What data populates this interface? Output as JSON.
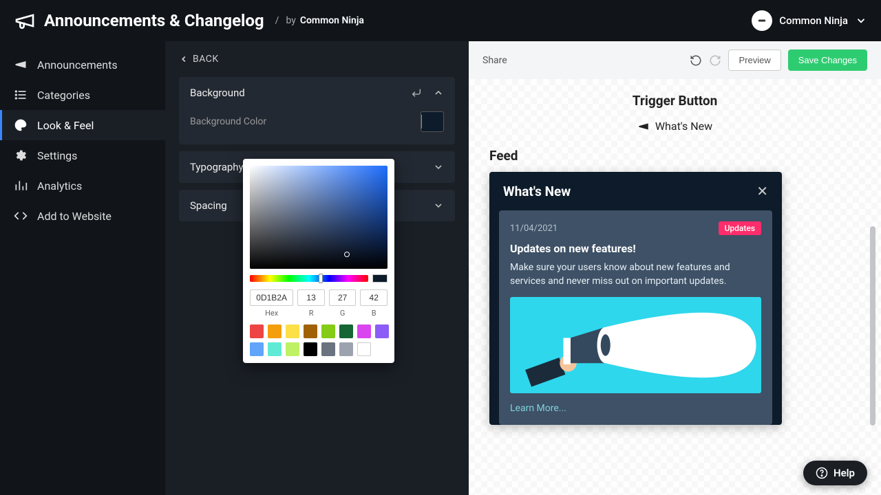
{
  "header": {
    "title": "Announcements & Changelog",
    "by_label": "by",
    "by_name": "Common Ninja",
    "user_name": "Common Ninja"
  },
  "sidebar": {
    "items": [
      {
        "label": "Announcements",
        "icon": "megaphone-icon"
      },
      {
        "label": "Categories",
        "icon": "list-icon"
      },
      {
        "label": "Look & Feel",
        "icon": "palette-icon",
        "active": true
      },
      {
        "label": "Settings",
        "icon": "gear-icon"
      },
      {
        "label": "Analytics",
        "icon": "chart-icon"
      },
      {
        "label": "Add to Website",
        "icon": "code-icon"
      }
    ]
  },
  "editor": {
    "back_label": "BACK",
    "sections": {
      "background": {
        "title": "Background",
        "field_label": "Background Color",
        "color": "#0D1B2A"
      },
      "typography": {
        "title": "Typography"
      },
      "spacing": {
        "title": "Spacing"
      }
    }
  },
  "color_picker": {
    "hex": "0D1B2A",
    "r": "13",
    "g": "27",
    "b": "42",
    "labels": {
      "hex": "Hex",
      "r": "R",
      "g": "G",
      "b": "B"
    },
    "presets": [
      "#ef4444",
      "#f59e0b",
      "#fde047",
      "#a16207",
      "#84cc16",
      "#166534",
      "#d946ef",
      "#8b5cf6",
      "#60a5fa",
      "#5eead4",
      "#bef264",
      "#000000",
      "#6b7280",
      "#9ca3af",
      "#ffffff"
    ]
  },
  "toolbar": {
    "share": "Share",
    "preview": "Preview",
    "save": "Save Changes"
  },
  "preview": {
    "trigger_title": "Trigger Button",
    "trigger_label": "What's New",
    "feed_title": "Feed",
    "widget_title": "What's New",
    "card": {
      "date": "11/04/2021",
      "tag": "Updates",
      "title": "Updates on new features!",
      "body": "Make sure your users know about new features and services and never miss out on important updates.",
      "learn": "Learn More..."
    }
  },
  "help_label": "Help"
}
